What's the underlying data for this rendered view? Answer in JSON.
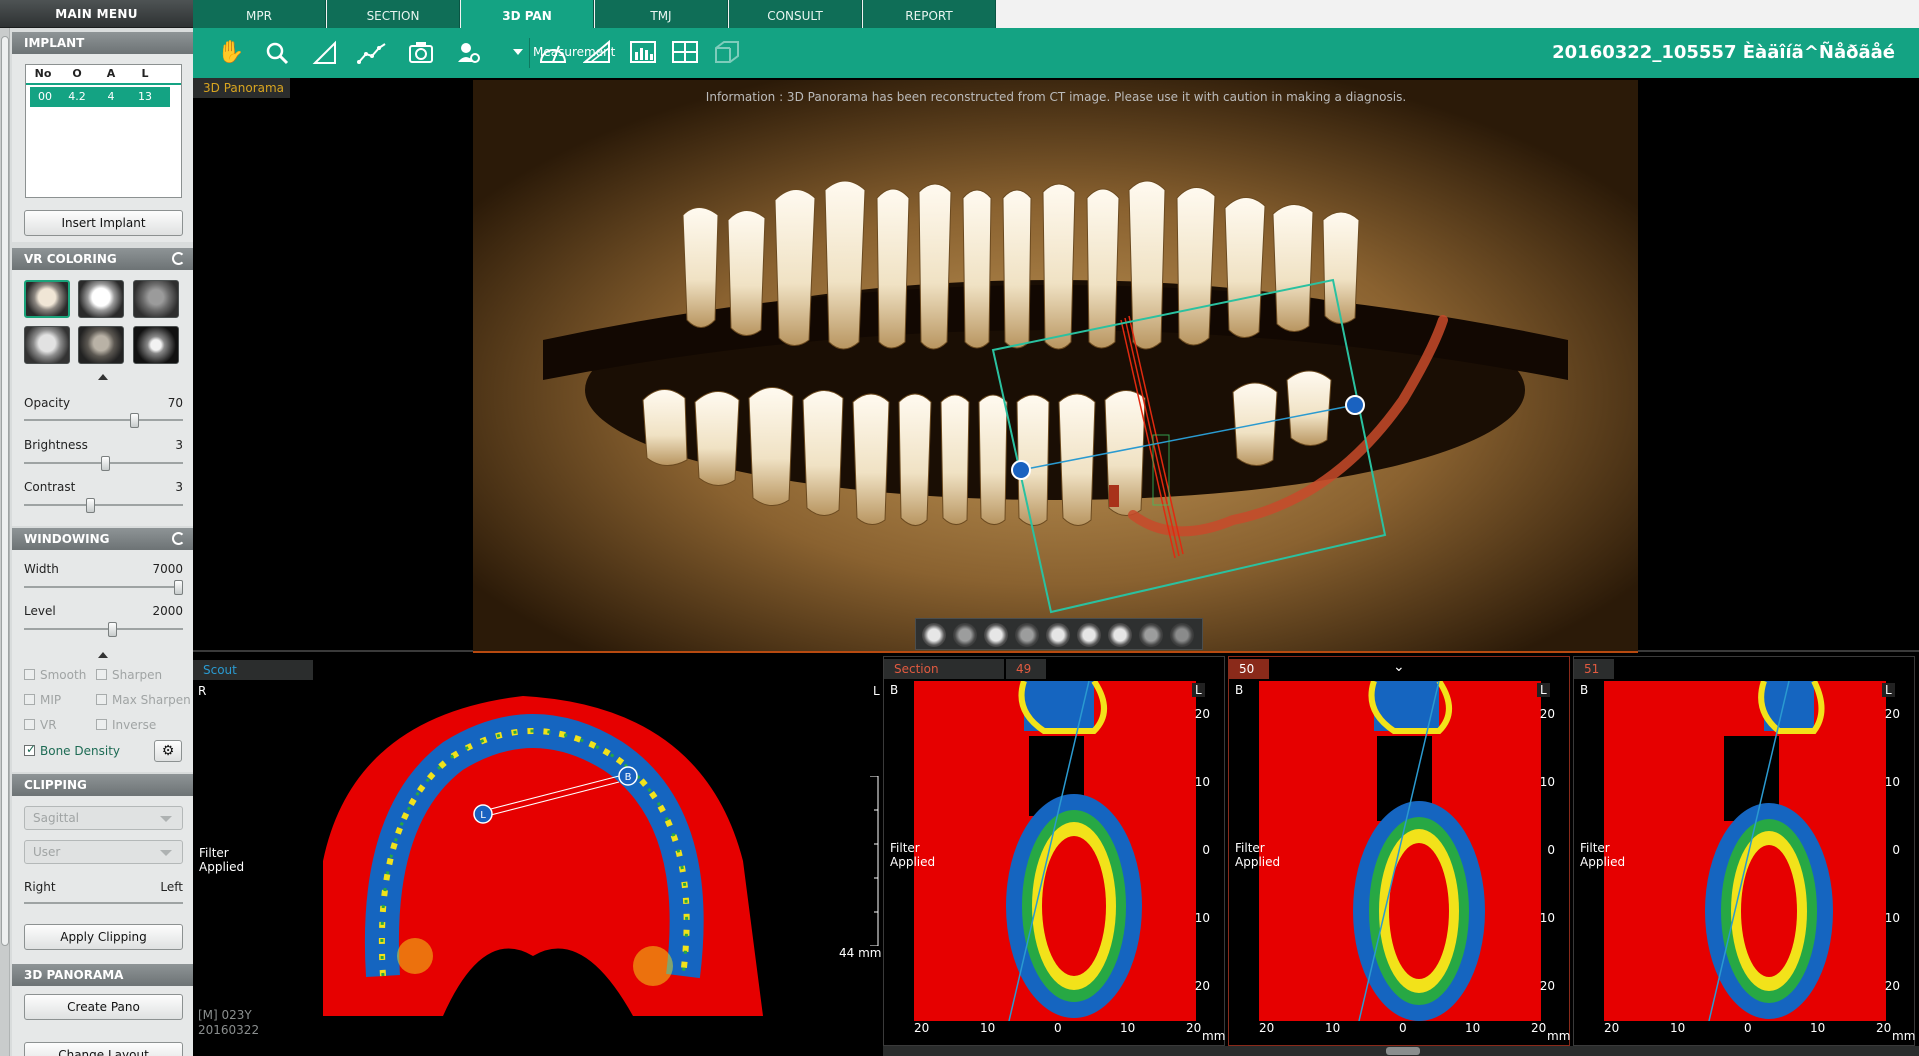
{
  "sidebar": {
    "main_menu": "MAIN MENU",
    "implant": {
      "title": "IMPLANT",
      "columns": [
        "No",
        "O",
        "A",
        "L"
      ],
      "rows": [
        [
          "00",
          "4.2",
          "4",
          "13"
        ]
      ],
      "insert_label": "Insert Implant"
    },
    "vr_coloring": {
      "title": "VR COLORING",
      "presets": [
        "bone-preset-icon",
        "skull-preset-icon",
        "gray-preset-icon",
        "skin-preset-icon",
        "tissue-preset-icon",
        "gear-skull-preset-icon"
      ],
      "opacity_label": "Opacity",
      "opacity_value": "70",
      "brightness_label": "Brightness",
      "brightness_value": "3",
      "contrast_label": "Contrast",
      "contrast_value": "3"
    },
    "windowing": {
      "title": "WINDOWING",
      "width_label": "Width",
      "width_value": "7000",
      "level_label": "Level",
      "level_value": "2000",
      "smooth": "Smooth",
      "sharpen": "Sharpen",
      "mip": "MIP",
      "max_sharpen": "Max Sharpen",
      "vr": "VR",
      "inverse": "Inverse",
      "bone_density": "Bone Density"
    },
    "clipping": {
      "title": "CLIPPING",
      "plane": "Sagittal",
      "mode": "User",
      "right_label": "Right",
      "left_label": "Left",
      "apply_label": "Apply Clipping"
    },
    "panorama": {
      "title": "3D PANORAMA",
      "create_label": "Create Pano",
      "layout_label": "Change Layout"
    }
  },
  "tabs": [
    "MPR",
    "SECTION",
    "3D PAN",
    "TMJ",
    "CONSULT",
    "REPORT"
  ],
  "active_tab": "3D PAN",
  "toolbar": {
    "measurement_label": "Measurement",
    "patient_id": "20160322_105557",
    "patient_name": "Èàäîíã^Ñåðãåé"
  },
  "pano": {
    "label": "3D Panorama",
    "info": "Information : 3D Panorama has been reconstructed from CT image. Please use it with caution in making a diagnosis."
  },
  "scout": {
    "label": "Scout",
    "r": "R",
    "l": "L",
    "filter": "Filter Applied",
    "scale": "44 mm",
    "patient_info": "[M] 023Y",
    "date": "20160322",
    "marker_l": "L",
    "marker_b": "B"
  },
  "sections": [
    {
      "label": "Section",
      "num": "49",
      "b": "B",
      "l": "L",
      "filter": "Filter Applied"
    },
    {
      "label": "",
      "num": "50",
      "b": "B",
      "l": "L",
      "filter": "Filter Applied"
    },
    {
      "label": "",
      "num": "51",
      "b": "B",
      "l": "L",
      "filter": "Filter Applied"
    }
  ],
  "section_axis": {
    "y_ticks": [
      "20",
      "10",
      "0",
      "10",
      "20"
    ],
    "x_ticks": [
      "20",
      "10",
      "0",
      "10",
      "20"
    ],
    "unit": "mm"
  },
  "colors": {
    "accent": "#14a383",
    "tab_dark": "#0f6e57",
    "density_red": "#e60000",
    "density_blue": "#1565c0",
    "density_yellow": "#f2e21a",
    "density_green": "#27a844"
  }
}
